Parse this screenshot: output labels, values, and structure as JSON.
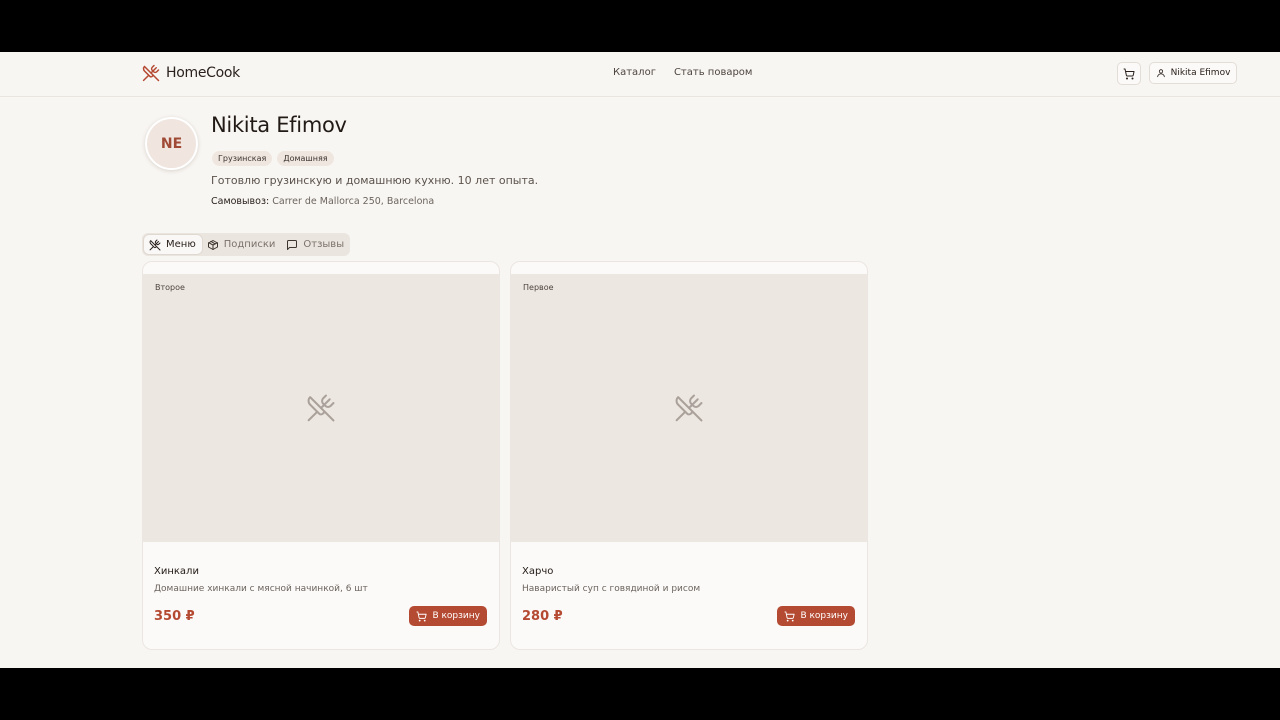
{
  "brand": {
    "name": "HomeCook",
    "logo_icon": "utensils-crossed-icon",
    "accent": "#b54a32"
  },
  "nav": {
    "catalog": "Каталог",
    "become_chef": "Стать поваром"
  },
  "header": {
    "cart_icon": "cart-icon",
    "user_name": "Nikita Efimov",
    "user_icon": "user-icon"
  },
  "profile": {
    "initials": "NE",
    "name": "Nikita Efimov",
    "tags": [
      "Грузинская",
      "Домашняя"
    ],
    "bio": "Готовлю грузинскую и домашнюю кухню. 10 лет опыта.",
    "pickup_label": "Самовывоз:",
    "pickup_address": "Carrer de Mallorca 250, Barcelona"
  },
  "tabs": [
    {
      "label": "Меню",
      "icon": "utensils-icon",
      "active": true
    },
    {
      "label": "Подписки",
      "icon": "box-icon",
      "active": false
    },
    {
      "label": "Отзывы",
      "icon": "chat-icon",
      "active": false
    }
  ],
  "dishes": [
    {
      "category": "Второе",
      "name": "Хинкали",
      "description": "Домашние хинкали с мясной начинкой, 6 шт",
      "price": "350 ₽",
      "button": "В корзину"
    },
    {
      "category": "Первое",
      "name": "Харчо",
      "description": "Наваристый суп с говядиной и рисом",
      "price": "280 ₽",
      "button": "В корзину"
    }
  ]
}
